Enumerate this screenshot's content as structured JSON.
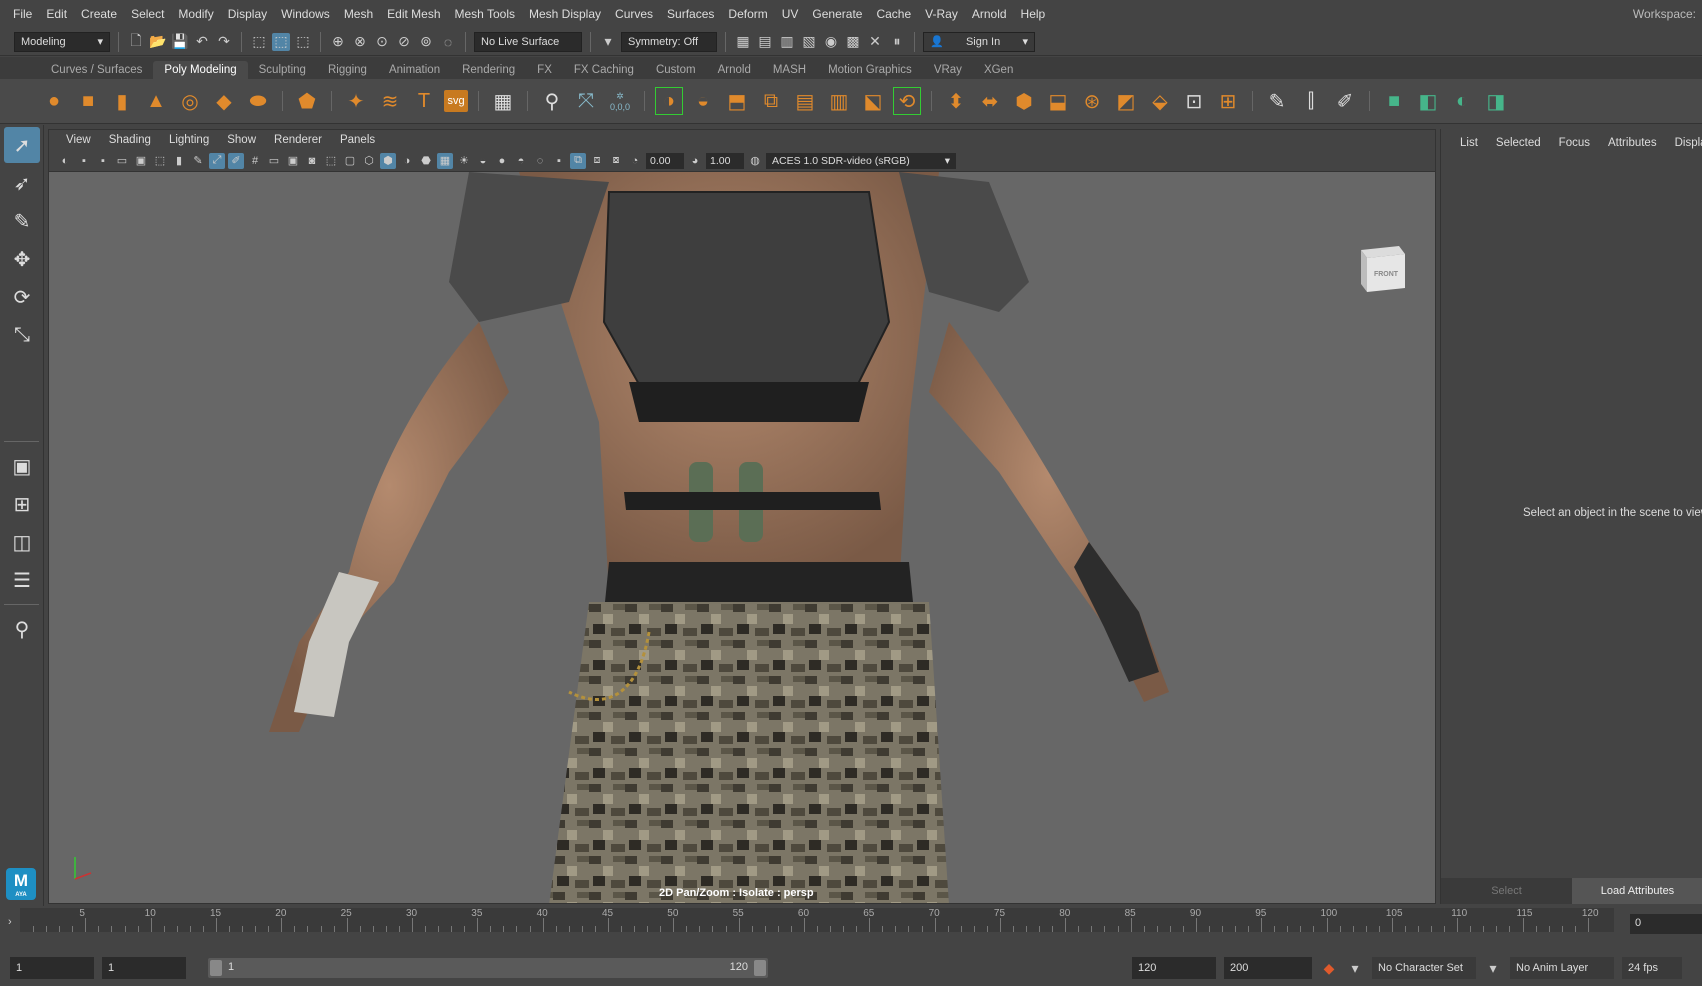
{
  "menubar": {
    "items": [
      "File",
      "Edit",
      "Create",
      "Select",
      "Modify",
      "Display",
      "Windows",
      "Mesh",
      "Edit Mesh",
      "Mesh Tools",
      "Mesh Display",
      "Curves",
      "Surfaces",
      "Deform",
      "UV",
      "Generate",
      "Cache",
      "V-Ray",
      "Arnold",
      "Help"
    ],
    "workspace_label": "Workspace:"
  },
  "statusline": {
    "mode": "Modeling",
    "live_surface": "No Live Surface",
    "symmetry": "Symmetry: Off",
    "sign_in": "Sign In"
  },
  "shelf": {
    "tabs": [
      "Curves / Surfaces",
      "Poly Modeling",
      "Sculpting",
      "Rigging",
      "Animation",
      "Rendering",
      "FX",
      "FX Caching",
      "Custom",
      "Arnold",
      "MASH",
      "Motion Graphics",
      "VRay",
      "XGen"
    ],
    "active_tab": "Poly Modeling",
    "svg_label": "svg",
    "coord_label": "0,0,0"
  },
  "viewport": {
    "menu": [
      "View",
      "Shading",
      "Lighting",
      "Show",
      "Renderer",
      "Panels"
    ],
    "exposure": "0.00",
    "gamma": "1.00",
    "color_space": "ACES 1.0 SDR-video (sRGB)",
    "hud": "2D Pan/Zoom : Isolate : persp",
    "viewcube_label": "FRONT"
  },
  "right_panel": {
    "tabs": [
      "List",
      "Selected",
      "Focus",
      "Attributes",
      "Display"
    ],
    "message": "Select an object in the scene to view",
    "select_button": "Select",
    "load_button": "Load Attributes"
  },
  "timeline": {
    "ticks": [
      "5",
      "10",
      "15",
      "20",
      "25",
      "30",
      "35",
      "40",
      "45",
      "50",
      "55",
      "60",
      "65",
      "70",
      "75",
      "80",
      "85",
      "90",
      "95",
      "100",
      "105",
      "110",
      "115",
      "120"
    ],
    "current_frame": "0"
  },
  "range": {
    "start": "1",
    "playback_start": "1",
    "slider_start": "1",
    "slider_end": "120",
    "playback_end": "120",
    "end": "200",
    "character_set": "No Character Set",
    "anim_layer": "No Anim Layer",
    "fps": "24 fps"
  },
  "logo": {
    "text": "M",
    "subtext": "AYA"
  },
  "colors": {
    "accent": "#5285a6",
    "shelf_icon": "#e08a2c",
    "maya_logo": "#1e8fc3"
  }
}
